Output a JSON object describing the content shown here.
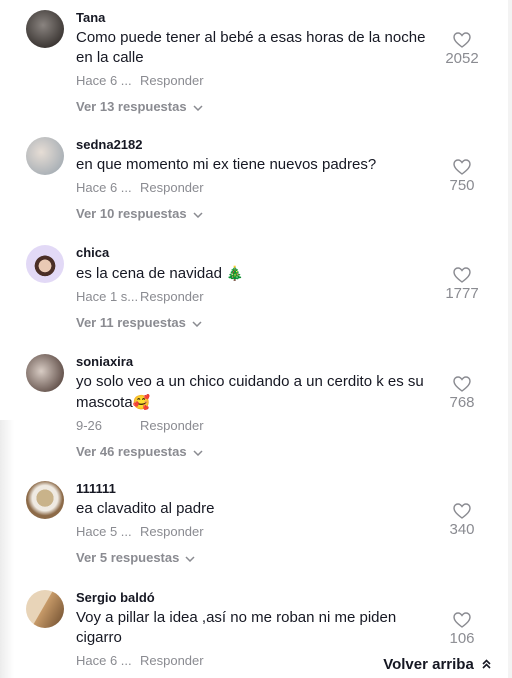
{
  "comments": [
    {
      "username": "Tana",
      "text": "Como puede tener al bebé a esas horas de la noche en la calle",
      "time": "Hace 6 ...",
      "reply_label": "Responder",
      "replies_label": "Ver 13 respuestas",
      "likes": "2052",
      "avatar_colors": [
        "#6f6a66",
        "#3a3532"
      ]
    },
    {
      "username": "sedna2182",
      "text": "en que momento mi ex tiene nuevos padres?",
      "time": "Hace 6 ...",
      "reply_label": "Responder",
      "replies_label": "Ver 10 respuestas",
      "likes": "750",
      "avatar_colors": [
        "#d8d2cc",
        "#9aa3ab"
      ]
    },
    {
      "username": "chica",
      "text": "es la cena de navidad",
      "emoji": "🎄",
      "time": "Hace 1 s...",
      "reply_label": "Responder",
      "replies_label": "Ver 11 respuestas",
      "likes": "1777",
      "avatar_colors": [
        "#e0d8f5",
        "#5a3a30"
      ]
    },
    {
      "username": "soniaxira",
      "text": "yo solo veo a un chico cuidando a un cerdito k es su mascota",
      "emoji": "🥰",
      "time": "9-26",
      "reply_label": "Responder",
      "replies_label": "Ver 46 respuestas",
      "likes": "768",
      "avatar_colors": [
        "#c9bdb6",
        "#5c4a44"
      ]
    },
    {
      "username": "111111",
      "text": "ea clavadito al padre",
      "time": "Hace 5 ...",
      "reply_label": "Responder",
      "replies_label": "Ver 5 respuestas",
      "likes": "340",
      "avatar_colors": [
        "#c6b08a",
        "#7b5a3a"
      ]
    },
    {
      "username": "Sergio baldó",
      "text": "Voy a pillar la idea ,así no me roban ni me piden cigarro",
      "time": "Hace 6 ...",
      "reply_label": "Responder",
      "likes": "106",
      "avatar_colors": [
        "#d6b48a",
        "#6b4a2c"
      ]
    }
  ],
  "back_to_top": {
    "label": "Volver arriba"
  },
  "icons": {
    "like": "heart-outline-icon",
    "expand": "chevron-down-icon",
    "back_top": "double-chevron-up-icon"
  }
}
